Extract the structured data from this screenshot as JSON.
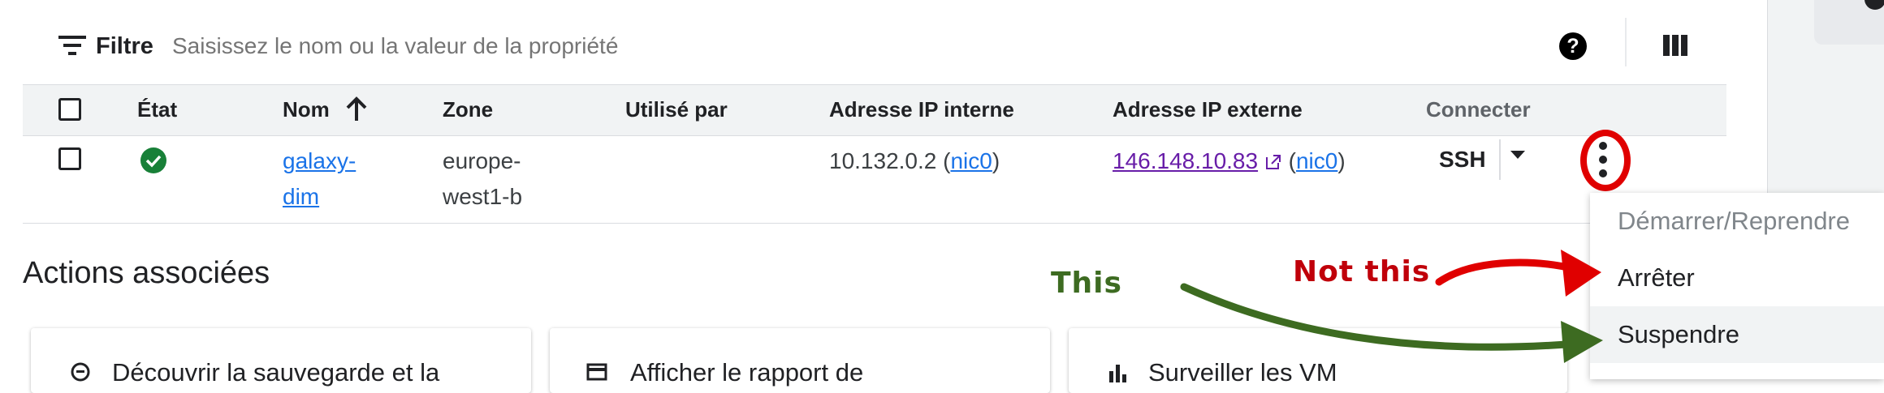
{
  "filter": {
    "label": "Filtre",
    "placeholder": "Saisissez le nom ou la valeur de la propriété",
    "help": "?"
  },
  "table": {
    "headers": {
      "state": "État",
      "name": "Nom",
      "zone": "Zone",
      "used_by": "Utilisé par",
      "internal_ip": "Adresse IP interne",
      "external_ip": "Adresse IP externe",
      "connect": "Connecter"
    },
    "row": {
      "name_line1": "galaxy-",
      "name_line2": "dim",
      "zone_line1": "europe-",
      "zone_line2": "west1-b",
      "used_by": "",
      "internal_ip": "10.132.0.2",
      "internal_nic": "nic0",
      "external_ip": "146.148.10.83",
      "external_nic": "nic0",
      "connect": "SSH",
      "status": "ok"
    }
  },
  "menu": {
    "items": [
      {
        "label": "Démarrer/Reprendre",
        "disabled": true
      },
      {
        "label": "Arrêter",
        "disabled": false
      },
      {
        "label": "Suspendre",
        "disabled": false
      }
    ]
  },
  "section": {
    "title": "Actions associées",
    "cards": [
      {
        "label": "Découvrir la sauvegarde et la",
        "icon": "backup-icon"
      },
      {
        "label": "Afficher le rapport de",
        "icon": "billing-card-icon"
      },
      {
        "label": "Surveiller les VM",
        "icon": "monitoring-bars-icon"
      }
    ]
  },
  "annotations": {
    "this": "This",
    "not_this": "Not this",
    "colors": {
      "this": "#3d6b21",
      "not_this": "#e00000"
    }
  },
  "colors": {
    "accent": "#1a73e8",
    "visited_link": "#681da8",
    "status_ok": "#188038",
    "header_bg": "#f1f3f4"
  }
}
